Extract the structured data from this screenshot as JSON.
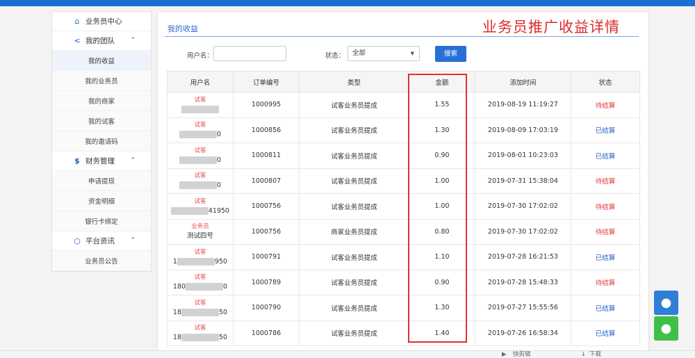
{
  "sidebar": {
    "home": "业务员中心",
    "team": {
      "label": "我的团队",
      "items": [
        "我的收益",
        "我的业务员",
        "我的商家",
        "我的试客",
        "我的邀请码"
      ]
    },
    "finance": {
      "label": "财务管理",
      "items": [
        "申请提现",
        "资金明细",
        "银行卡绑定"
      ]
    },
    "news": {
      "label": "平台资讯",
      "items": [
        "业务员公告"
      ]
    }
  },
  "main": {
    "tab_title": "我的收益",
    "promo_title": "业务员推广收益详情",
    "filter": {
      "username_label": "用户名：",
      "username_value": "",
      "status_label": "状态：",
      "status_value": "全部",
      "search_button": "搜索"
    },
    "table": {
      "headers": [
        "用户名",
        "订单编号",
        "类型",
        "金额",
        "添加时间",
        "状态"
      ],
      "rows": [
        {
          "role": "试客",
          "name_tail": "",
          "order": "1000995",
          "type": "试客业务员提成",
          "amount": "1.55",
          "time": "2019-08-19 11:19:27",
          "status": "待结算",
          "pending": true
        },
        {
          "role": "试客",
          "name_tail": "0",
          "order": "1000856",
          "type": "试客业务员提成",
          "amount": "1.30",
          "time": "2019-08-09 17:03:19",
          "status": "已结算",
          "pending": false
        },
        {
          "role": "试客",
          "name_tail": "0",
          "order": "1000811",
          "type": "试客业务员提成",
          "amount": "0.90",
          "time": "2019-08-01 10:23:03",
          "status": "已结算",
          "pending": false
        },
        {
          "role": "试客",
          "name_tail": "0",
          "order": "1000807",
          "type": "试客业务员提成",
          "amount": "1.00",
          "time": "2019-07-31 15:38:04",
          "status": "待结算",
          "pending": true
        },
        {
          "role": "试客",
          "name_tail": "41950",
          "order": "1000756",
          "type": "试客业务员提成",
          "amount": "1.00",
          "time": "2019-07-30 17:02:02",
          "status": "待结算",
          "pending": true
        },
        {
          "role": "业务员",
          "name_tail": "测试四号",
          "order": "1000756",
          "type": "商家业务员提成",
          "amount": "0.80",
          "time": "2019-07-30 17:02:02",
          "status": "待结算",
          "pending": true,
          "plain_name": true
        },
        {
          "role": "试客",
          "name_head": "1",
          "name_tail": "950",
          "order": "1000791",
          "type": "试客业务员提成",
          "amount": "1.10",
          "time": "2019-07-28 16:21:53",
          "status": "已结算",
          "pending": false
        },
        {
          "role": "试客",
          "name_head": "180",
          "name_tail": "0",
          "order": "1000789",
          "type": "试客业务员提成",
          "amount": "0.90",
          "time": "2019-07-28 15:48:33",
          "status": "待结算",
          "pending": true
        },
        {
          "role": "试客",
          "name_head": "18",
          "name_tail": "50",
          "order": "1000790",
          "type": "试客业务员提成",
          "amount": "1.30",
          "time": "2019-07-27 15:55:56",
          "status": "已结算",
          "pending": false
        },
        {
          "role": "试客",
          "name_head": "18",
          "name_tail": "50",
          "order": "1000786",
          "type": "试客业务员提成",
          "amount": "1.40",
          "time": "2019-07-26 16:58:34",
          "status": "已结算",
          "pending": false
        }
      ]
    }
  },
  "toolbar": {
    "video": "快剪辑",
    "download": "下载"
  },
  "colors": {
    "accent": "#2670d8",
    "pending": "#e23b3b",
    "done": "#2b63c9",
    "annotation": "#e03030"
  },
  "icons": {
    "home": "home-icon",
    "team": "share-icon",
    "finance": "dollar-icon",
    "news": "chat-icon",
    "qq": "qq-icon",
    "wechat": "wechat-icon"
  }
}
